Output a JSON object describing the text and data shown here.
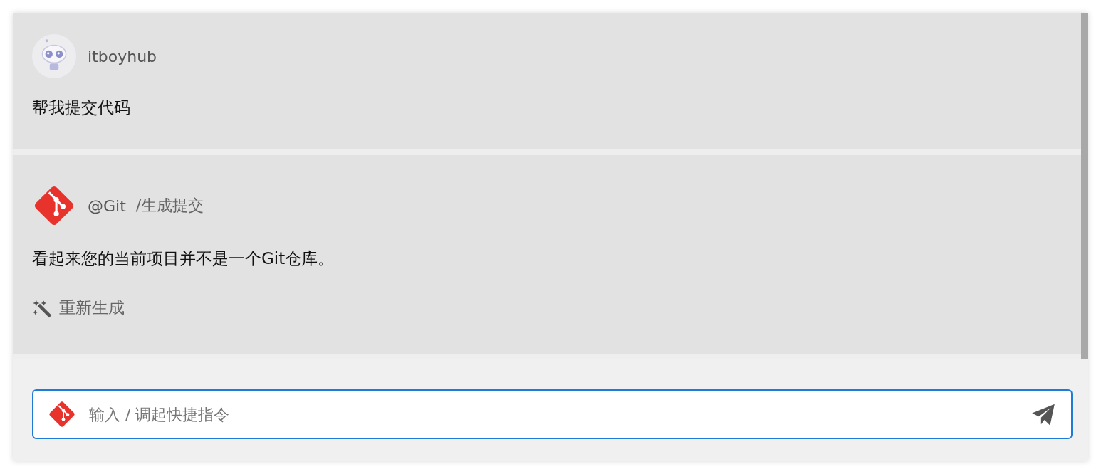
{
  "messages": [
    {
      "kind": "user",
      "author": "itboyhub",
      "text": "帮我提交代码"
    },
    {
      "kind": "agent",
      "author": "@Git",
      "command": "/生成提交",
      "text": "看起来您的当前项目并不是一个Git仓库。",
      "action": "重新生成"
    }
  ],
  "composer": {
    "placeholder": "输入 / 调起快捷指令"
  }
}
